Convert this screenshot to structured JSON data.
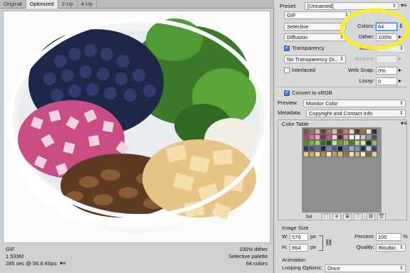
{
  "tabs": [
    {
      "label": "Original"
    },
    {
      "label": "Optimized"
    },
    {
      "label": "2-Up"
    },
    {
      "label": "4-Up"
    }
  ],
  "status": {
    "format": "GIF",
    "size": "1.533M",
    "time": "285 sec @ 56.6 Kbps",
    "dither": "100% dither",
    "palette": "Selective palette",
    "colors": "64 colors",
    "menu_icon": "panel-menu-icon"
  },
  "settings": {
    "preset_label": "Preset:",
    "preset_value": "[Unnamed]",
    "format_value": "GIF",
    "reduction_value": "Selective",
    "colors_label": "Colors:",
    "colors_value": "64",
    "dither_algo_value": "Diffusion",
    "dither_label": "Dither:",
    "dither_value": "100%",
    "transparency_label": "Transparency",
    "transparency_checked": true,
    "matte_label": "Matte:",
    "trans_dither_value": "No Transparency Di...",
    "amount_label": "Amount:",
    "interlaced_label": "Interlaced",
    "interlaced_checked": false,
    "websnap_label": "Web Snap:",
    "websnap_value": "0%",
    "lossy_label": "Lossy:",
    "lossy_value": "0",
    "convert_label": "Convert to sRGB",
    "convert_checked": true,
    "preview_label": "Preview:",
    "preview_value": "Monitor Color",
    "metadata_label": "Metadata:",
    "metadata_value": "Copyright and Contact Info"
  },
  "color_table": {
    "title": "Color Table",
    "count": "64",
    "swatches": [
      "#6b5a4a",
      "#8a7a68",
      "#c9b9a5",
      "#5e4a3a",
      "#a07e5a",
      "#d7c2a2",
      "#7b4a2e",
      "#b58a5e",
      "#e6d6c0",
      "#4c3a2a",
      "#9c6a45",
      "#f0e5d5",
      "#3e2e22",
      "#c63c6a",
      "#e06a8a",
      "#f3a5bd",
      "#8a2a4a",
      "#b95a7a",
      "#f5d0dd",
      "#5b1e35",
      "#d887a2",
      "#ffffff",
      "#eeeeee",
      "#cccccc",
      "#999999",
      "#555555",
      "#5a8a2e",
      "#7fb03e",
      "#a8d060",
      "#3e6a22",
      "#2c4a18",
      "#c7e08a",
      "#6a9a3a",
      "#8fc050",
      "#4e7a28",
      "#b2d678",
      "#d9eeb0",
      "#1e3210",
      "#94b86a",
      "#2e3a6a",
      "#3e4e8a",
      "#5a6aa8",
      "#1e2648",
      "#7a86c0",
      "#4a5a96",
      "#141a32",
      "#6070a0",
      "#a0aad6",
      "#8090c8",
      "#242e58",
      "#c0c8e8",
      "#3a4478",
      "#e8c888",
      "#d4a860",
      "#f2dcaa",
      "#b88a48",
      "#fae8c4",
      "#c89a58",
      "#e0b878",
      "#a07838",
      "#f6e0b8",
      "#dcb070",
      "#fff4dc",
      "#8a6430",
      "#ecd098"
    ]
  },
  "image_size": {
    "title": "Image Size",
    "w_label": "W:",
    "w_value": "576",
    "h_label": "H:",
    "h_value": "864",
    "unit": "px",
    "percent_label": "Percent:",
    "percent_value": "100",
    "percent_unit": "%",
    "quality_label": "Quality:",
    "quality_value": "Bicubic"
  },
  "animation": {
    "title": "Animation",
    "looping_label": "Looping Options:",
    "looping_value": "Once"
  }
}
